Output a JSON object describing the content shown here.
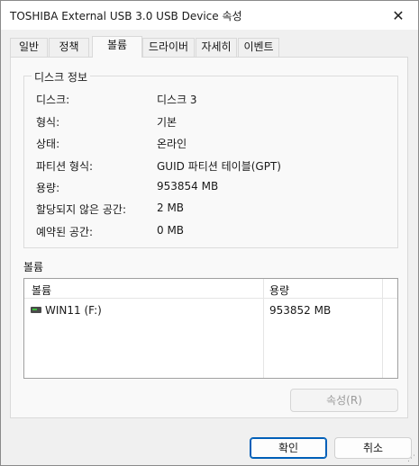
{
  "window": {
    "title": "TOSHIBA External USB 3.0 USB Device 속성",
    "close_glyph": "✕"
  },
  "tabs": [
    {
      "label": "일반",
      "active": false
    },
    {
      "label": "정책",
      "active": false
    },
    {
      "label": "볼륨",
      "active": true
    },
    {
      "label": "드라이버",
      "active": false
    },
    {
      "label": "자세히",
      "active": false
    },
    {
      "label": "이벤트",
      "active": false
    }
  ],
  "disk_info": {
    "group_label": "디스크 정보",
    "rows": [
      {
        "key": "디스크:",
        "value": "디스크 3"
      },
      {
        "key": "형식:",
        "value": "기본"
      },
      {
        "key": "상태:",
        "value": "온라인"
      },
      {
        "key": "파티션 형식:",
        "value": "GUID 파티션 테이블(GPT)"
      },
      {
        "key": "용량:",
        "value": "953854 MB"
      },
      {
        "key": "할당되지 않은 공간:",
        "value": "2 MB"
      },
      {
        "key": "예약된 공간:",
        "value": "0 MB"
      }
    ]
  },
  "volumes": {
    "label": "볼륨",
    "columns": [
      "볼륨",
      "용량"
    ],
    "rows": [
      {
        "icon": "drive-icon",
        "name": "WIN11 (F:)",
        "size": "953852 MB"
      }
    ]
  },
  "buttons": {
    "properties": "속성(R)",
    "ok": "확인",
    "cancel": "취소"
  },
  "colors": {
    "accent": "#005fb8",
    "disabled_text": "#9a9a9a"
  }
}
